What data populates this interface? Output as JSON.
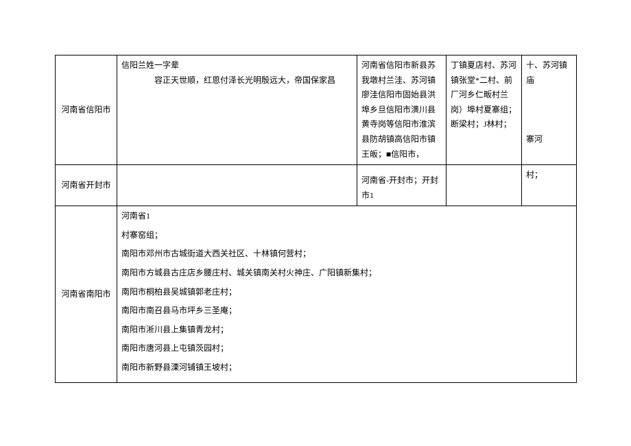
{
  "rows": [
    {
      "label": "河南省信阳市",
      "col2_line1": "信阳兰姓一字辈",
      "col2_line2": "容正天世顺，红恩付泽长光明殷远大，帝国保家昌",
      "col3": "河南省信阳市新县苏我墩村兰洼、苏河镇廖洼信阳市固始县洪埠乡旦信阳市潢川县黄寺岗等信阳市淮滨县防胡镇高信阳市镇王皈；■信阳市，",
      "col4": "丁镇夏店村、苏河镇张堂*二村、前厂河乡仁畈村兰岗）埠村夏寨组；断梁村；J林村；",
      "col5": "十、苏河镇庙\n\n\n\n寨河"
    },
    {
      "label": "河南省开封市",
      "col2": "",
      "col3": "河南省-开封市；开封市1",
      "col4": "",
      "col5": "村；"
    },
    {
      "label": "河南省南阳市",
      "merged_lines": [
        "河南省1",
        "村寨窑组；",
        "南阳市邓州市古城街道大西关社区、十林镇何营村；",
        "南阳市方城县古庄店乡腰庄村、城关镇南关村火神庄、广阳镇新集村；",
        "南阳市桐柏县吴城镇郭老庄村；",
        "南阳市南召县马市坪乡三圣庵；",
        "南阳市淅川县上集镇青龙村；",
        "南阳市唐河县上屯镇茨园村；",
        "南阳市新野县溧河铺镇王坡村；"
      ]
    }
  ]
}
